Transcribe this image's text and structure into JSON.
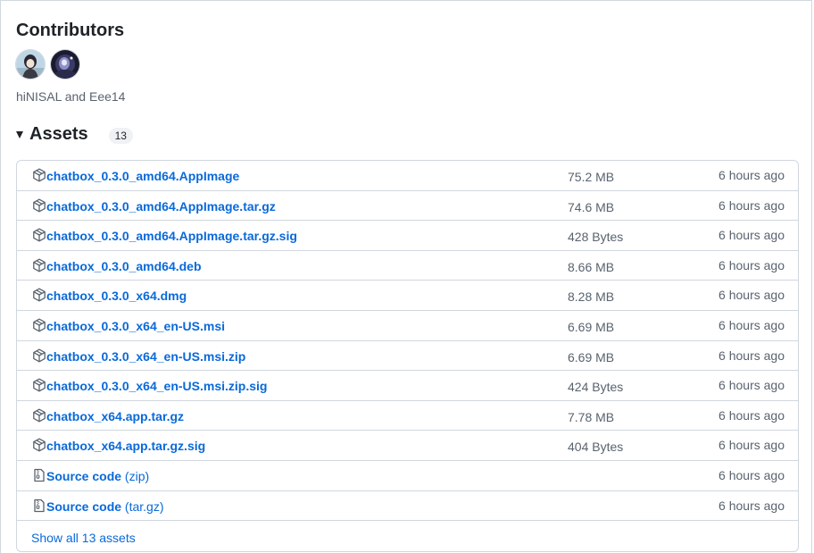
{
  "contributors": {
    "title": "Contributors",
    "names": "hiNISAL and Eee14",
    "avatars": [
      {
        "user": "hiNISAL"
      },
      {
        "user": "Eee14"
      }
    ]
  },
  "assets": {
    "title": "Assets",
    "count": "13",
    "show_all": "Show all 13 assets",
    "items": [
      {
        "icon": "package-icon",
        "name": "chatbox_0.3.0_amd64.AppImage",
        "size": "75.2 MB",
        "time": "6 hours ago"
      },
      {
        "icon": "package-icon",
        "name": "chatbox_0.3.0_amd64.AppImage.tar.gz",
        "size": "74.6 MB",
        "time": "6 hours ago"
      },
      {
        "icon": "package-icon",
        "name": "chatbox_0.3.0_amd64.AppImage.tar.gz.sig",
        "size": "428 Bytes",
        "time": "6 hours ago"
      },
      {
        "icon": "package-icon",
        "name": "chatbox_0.3.0_amd64.deb",
        "size": "8.66 MB",
        "time": "6 hours ago"
      },
      {
        "icon": "package-icon",
        "name": "chatbox_0.3.0_x64.dmg",
        "size": "8.28 MB",
        "time": "6 hours ago"
      },
      {
        "icon": "package-icon",
        "name": "chatbox_0.3.0_x64_en-US.msi",
        "size": "6.69 MB",
        "time": "6 hours ago"
      },
      {
        "icon": "package-icon",
        "name": "chatbox_0.3.0_x64_en-US.msi.zip",
        "size": "6.69 MB",
        "time": "6 hours ago"
      },
      {
        "icon": "package-icon",
        "name": "chatbox_0.3.0_x64_en-US.msi.zip.sig",
        "size": "424 Bytes",
        "time": "6 hours ago"
      },
      {
        "icon": "package-icon",
        "name": "chatbox_x64.app.tar.gz",
        "size": "7.78 MB",
        "time": "6 hours ago"
      },
      {
        "icon": "package-icon",
        "name": "chatbox_x64.app.tar.gz.sig",
        "size": "404 Bytes",
        "time": "6 hours ago"
      },
      {
        "icon": "file-zip-icon",
        "name": "Source code",
        "suffix": "(zip)",
        "size": "",
        "time": "6 hours ago"
      },
      {
        "icon": "file-zip-icon",
        "name": "Source code",
        "suffix": "(tar.gz)",
        "size": "",
        "time": "6 hours ago"
      }
    ]
  }
}
